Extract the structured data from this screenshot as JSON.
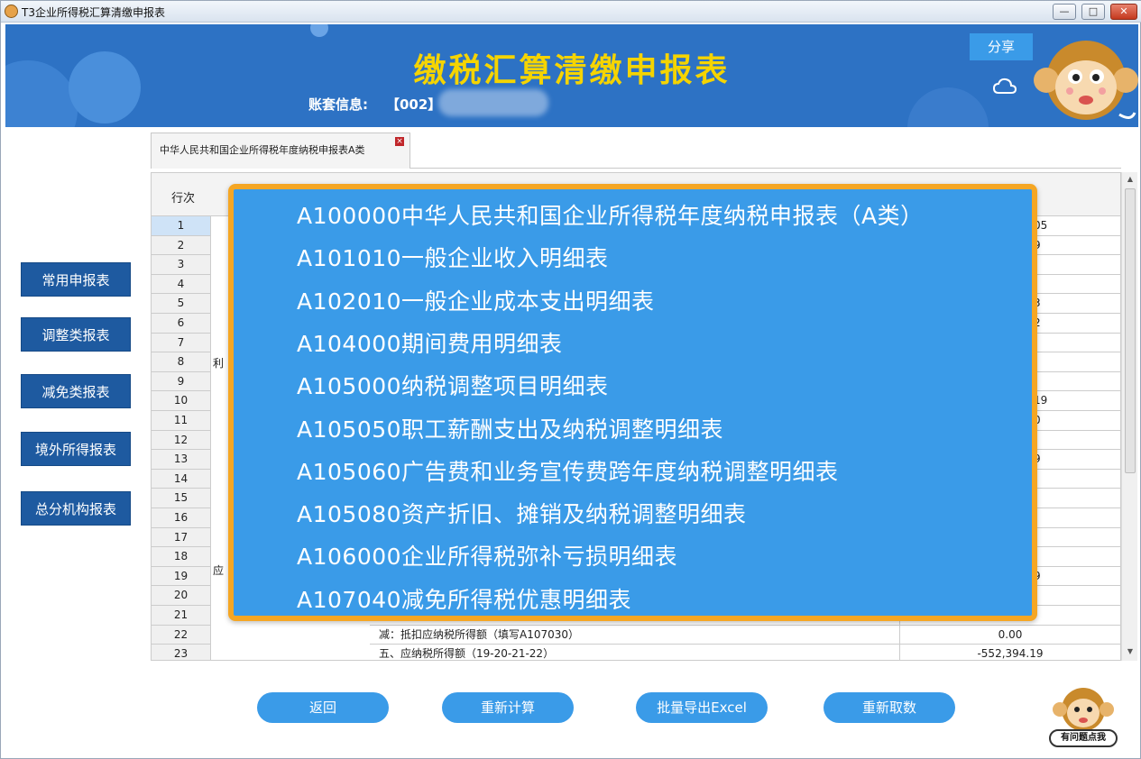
{
  "window": {
    "title": "T3企业所得税汇算清缴申报表",
    "min_label": "—",
    "max_label": "□",
    "close_label": "✕"
  },
  "header": {
    "title": "缴税汇算清缴申报表",
    "account_label": "账套信息:",
    "account_code": "【002】",
    "share_label": "分享"
  },
  "nav": [
    {
      "label": "常用申报表"
    },
    {
      "label": "调整类报表"
    },
    {
      "label": "减免类报表"
    },
    {
      "label": "境外所得报表"
    },
    {
      "label": "总分机构报表"
    }
  ],
  "tab": {
    "label": "中华人民共和国企业所得税年度纳税申报表A类",
    "close": "×"
  },
  "table": {
    "header_rownum": "行次",
    "categories": [
      "利",
      "应"
    ],
    "rows": [
      {
        "n": "1",
        "val": "05"
      },
      {
        "n": "2",
        "val": "9"
      },
      {
        "n": "3",
        "val": ""
      },
      {
        "n": "4",
        "val": ""
      },
      {
        "n": "5",
        "val": "3"
      },
      {
        "n": "6",
        "val": "2"
      },
      {
        "n": "7",
        "val": ""
      },
      {
        "n": "8",
        "val": ""
      },
      {
        "n": "9",
        "val": ""
      },
      {
        "n": "10",
        "val": "19"
      },
      {
        "n": "11",
        "val": "0"
      },
      {
        "n": "12",
        "val": ""
      },
      {
        "n": "13",
        "val": "9"
      },
      {
        "n": "14",
        "val": ""
      },
      {
        "n": "15",
        "val": ""
      },
      {
        "n": "16",
        "val": ""
      },
      {
        "n": "17",
        "val": ""
      },
      {
        "n": "18",
        "val": ""
      },
      {
        "n": "19",
        "val": "9"
      },
      {
        "n": "20",
        "val": ""
      },
      {
        "n": "21",
        "val": ""
      },
      {
        "n": "22",
        "desc": "减：抵扣应纳税所得额（填写A107030）",
        "val": "0.00"
      },
      {
        "n": "23",
        "desc": "五、应纳税所得额（19-20-21-22）",
        "val": "-552,394.19"
      }
    ]
  },
  "popup": {
    "items": [
      "A100000中华人民共和国企业所得税年度纳税申报表（A类）",
      "A101010一般企业收入明细表",
      "A102010一般企业成本支出明细表",
      "A104000期间费用明细表",
      "A105000纳税调整项目明细表",
      "A105050职工薪酬支出及纳税调整明细表",
      "A105060广告费和业务宣传费跨年度纳税调整明细表",
      "A105080资产折旧、摊销及纳税调整明细表",
      "A106000企业所得税弥补亏损明细表",
      "A107040减免所得税优惠明细表"
    ]
  },
  "footer": {
    "back": "返回",
    "recalc": "重新计算",
    "export": "批量导出Excel",
    "refetch": "重新取数",
    "help": "有问题点我"
  }
}
